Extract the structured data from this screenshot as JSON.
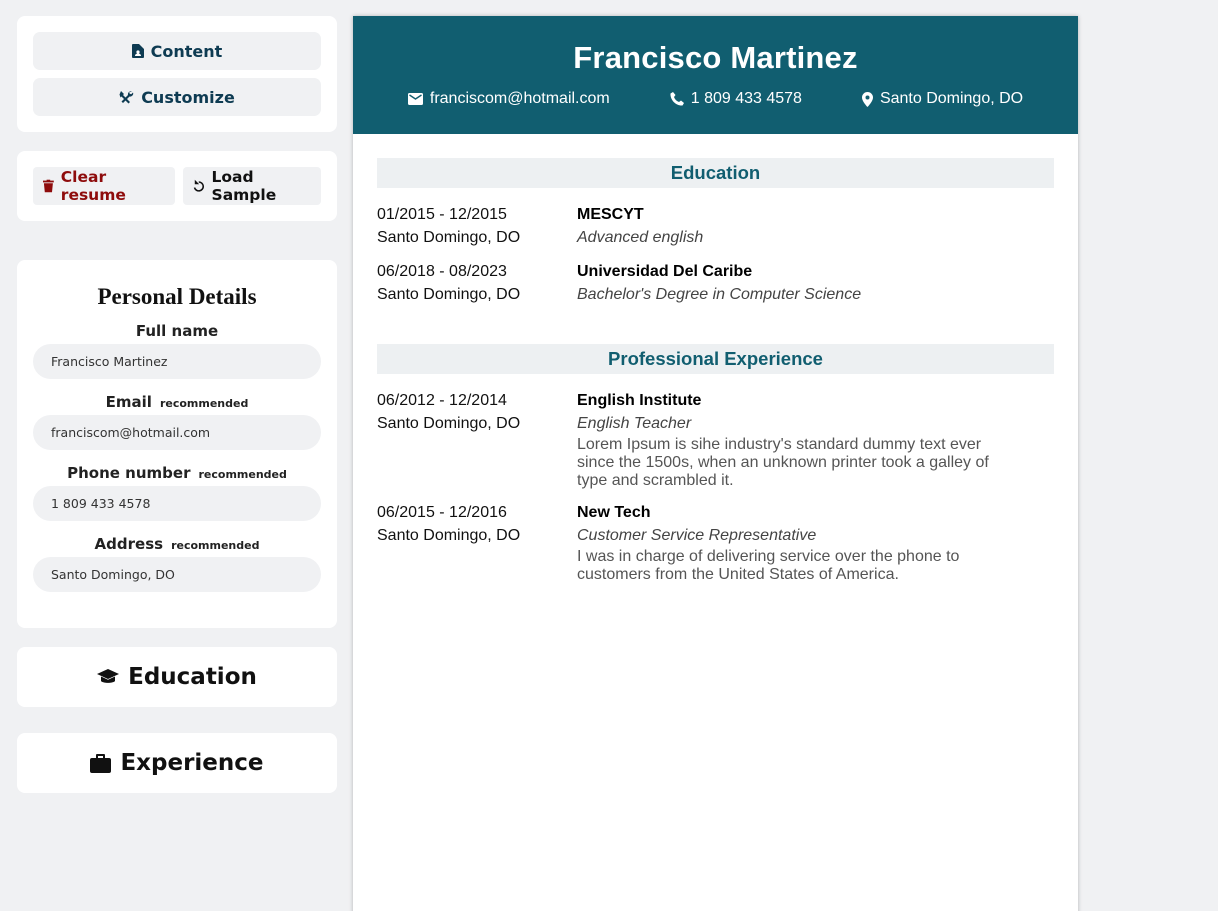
{
  "nav": {
    "content_label": "Content",
    "customize_label": "Customize"
  },
  "actions": {
    "clear_label": "Clear resume",
    "load_label": "Load Sample"
  },
  "personal_details": {
    "title": "Personal Details",
    "recommended_tag": "recommended",
    "fields": {
      "full_name": {
        "label": "Full name",
        "value": "Francisco Martinez"
      },
      "email": {
        "label": "Email",
        "value": "franciscom@hotmail.com"
      },
      "phone": {
        "label": "Phone number",
        "value": "1 809 433 4578"
      },
      "address": {
        "label": "Address",
        "value": "Santo Domingo, DO"
      }
    }
  },
  "sections": {
    "education_label": "Education",
    "experience_label": "Experience"
  },
  "resume": {
    "name": "Francisco Martinez",
    "email": "franciscom@hotmail.com",
    "phone": "1 809 433 4578",
    "location": "Santo Domingo, DO",
    "header_color": "#115e70",
    "education_heading": "Education",
    "experience_heading": "Professional Experience",
    "education": [
      {
        "dates": "01/2015 - 12/2015",
        "location": "Santo Domingo, DO",
        "school": "MESCYT",
        "degree": "Advanced english"
      },
      {
        "dates": "06/2018 - 08/2023",
        "location": "Santo Domingo, DO",
        "school": "Universidad Del Caribe",
        "degree": "Bachelor's Degree in Computer Science"
      }
    ],
    "experience": [
      {
        "dates": "06/2012 - 12/2014",
        "location": "Santo Domingo, DO",
        "company": "English Institute",
        "position": "English Teacher",
        "description": "Lorem Ipsum is sihe industry's standard dummy text ever since the 1500s, when an unknown printer took a galley of type and scrambled it."
      },
      {
        "dates": "06/2015 - 12/2016",
        "location": "Santo Domingo, DO",
        "company": "New Tech",
        "position": "Customer Service Representative",
        "description": "I was in charge of delivering service over the phone to customers from the United States of America."
      }
    ]
  }
}
